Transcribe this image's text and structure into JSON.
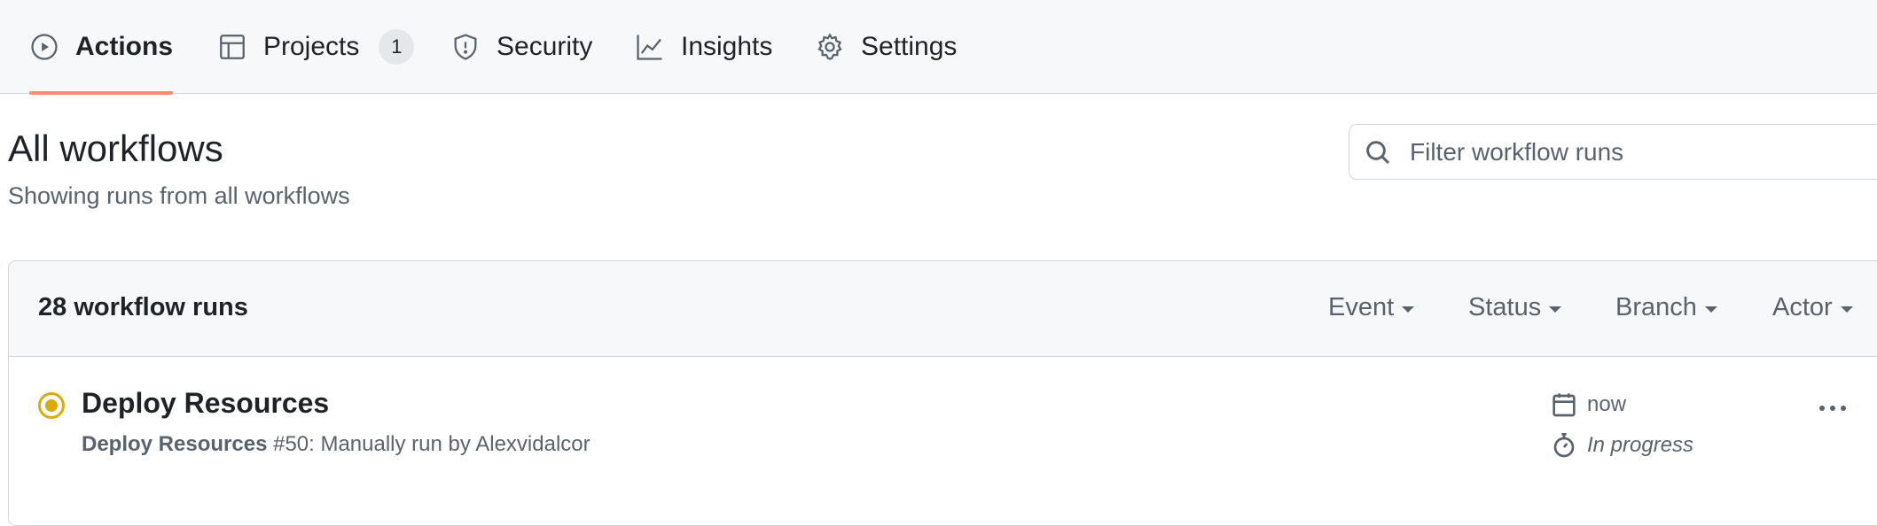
{
  "tabs": [
    {
      "label": "Actions",
      "icon": "play-icon",
      "active": true
    },
    {
      "label": "Projects",
      "icon": "table-icon",
      "counter": "1"
    },
    {
      "label": "Security",
      "icon": "shield-icon"
    },
    {
      "label": "Insights",
      "icon": "graph-icon"
    },
    {
      "label": "Settings",
      "icon": "gear-icon"
    }
  ],
  "accent_color": "#fd8c73",
  "page": {
    "title": "All workflows",
    "subtitle": "Showing runs from all workflows"
  },
  "search": {
    "placeholder": "Filter workflow runs",
    "value": ""
  },
  "runs": {
    "count_label": "28 workflow runs",
    "filters": [
      "Event",
      "Status",
      "Branch",
      "Actor"
    ],
    "items": [
      {
        "title": "Deploy Resources",
        "workflow": "Deploy Resources",
        "detail": " #50: Manually run by Alexvidalcor",
        "time": "now",
        "duration": "In progress",
        "status": "in-progress",
        "status_color": "#dbab0a"
      }
    ]
  }
}
